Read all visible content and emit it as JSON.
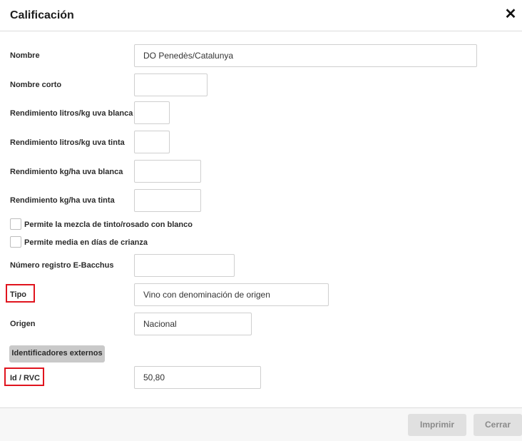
{
  "dialog": {
    "title": "Calificación"
  },
  "fields": {
    "nombre": {
      "label": "Nombre",
      "value": "DO Penedès/Catalunya"
    },
    "nombre_corto": {
      "label": "Nombre corto",
      "value": ""
    },
    "rend_litros_blanca": {
      "label": "Rendimiento litros/kg uva blanca",
      "value": ""
    },
    "rend_litros_tinta": {
      "label": "Rendimiento litros/kg uva tinta",
      "value": ""
    },
    "rend_kg_blanca": {
      "label": "Rendimiento kg/ha uva blanca",
      "value": ""
    },
    "rend_kg_tinta": {
      "label": "Rendimiento kg/ha uva tinta",
      "value": ""
    },
    "registro": {
      "label": "Número registro E-Bacchus",
      "value": ""
    },
    "tipo": {
      "label": "Tipo",
      "value": "Vino con denominación de origen"
    },
    "origen": {
      "label": "Origen",
      "value": "Nacional"
    },
    "id_rvc": {
      "label": "Id / RVC",
      "value": "50,80"
    }
  },
  "checkboxes": {
    "mezcla": {
      "label": "Permite la mezcla de tinto/rosado con blanco",
      "checked": false
    },
    "media": {
      "label": "Permite media en días de crianza",
      "checked": false
    }
  },
  "section": {
    "label": "Identificadores externos"
  },
  "footer": {
    "print_label": "Imprimir",
    "close_label": "Cerrar"
  },
  "colors": {
    "highlight": "#e0141e",
    "section_bg": "#c9c9c9",
    "button_bg": "#e0e0e0"
  }
}
